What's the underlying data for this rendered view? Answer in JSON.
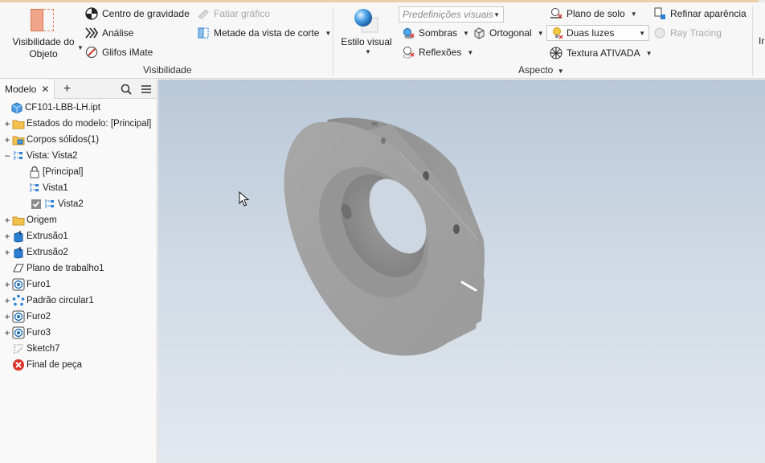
{
  "ribbon": {
    "visibilidade": {
      "object_visibility_label_1": "Visibilidade do",
      "object_visibility_label_2": "Objeto",
      "center_of_gravity": "Centro de gravidade",
      "analysis": "Análise",
      "imate_glyphs": "Glifos iMate",
      "slice_graphics": "Fatiar gráfico",
      "half_section_view": "Metade da vista de corte",
      "group_label": "Visibilidade"
    },
    "aspecto": {
      "visual_style": "Estilo visual",
      "visual_presets_placeholder": "Predefinições visuais",
      "shadows": "Sombras",
      "orthographic": "Ortogonal",
      "reflections": "Reflexões",
      "ground_plane": "Plano de solo",
      "two_lights": "Duas luzes",
      "texture_on": "Textura ATIVADA",
      "refine_appearance": "Refinar aparência",
      "ray_tracing": "Ray Tracing",
      "group_label": "Aspecto"
    },
    "next_group_partial": "Ir"
  },
  "browser": {
    "tab_label": "Modelo",
    "close_glyph": "✕",
    "add_glyph": "+",
    "tree": [
      {
        "label": "CF101-LBB-LH.ipt",
        "icon": "part-icon"
      },
      {
        "label": "Estados do modelo: [Principal]",
        "icon": "folder-icon"
      },
      {
        "label": "Corpos sólidos(1)",
        "icon": "folder-solid-icon"
      },
      {
        "label": "Vista: Vista2",
        "icon": "view-rep-icon"
      },
      {
        "label": "[Principal]",
        "icon": "lock-icon"
      },
      {
        "label": "Vista1",
        "icon": "view-rep-icon"
      },
      {
        "label": "Vista2",
        "icon": "view-rep-icon"
      },
      {
        "label": "Origem",
        "icon": "folder-icon"
      },
      {
        "label": "Extrusão1",
        "icon": "extrude-icon"
      },
      {
        "label": "Extrusão2",
        "icon": "extrude-icon"
      },
      {
        "label": "Plano de trabalho1",
        "icon": "workplane-icon"
      },
      {
        "label": "Furo1",
        "icon": "hole-icon"
      },
      {
        "label": "Padrão circular1",
        "icon": "circular-pattern-icon"
      },
      {
        "label": "Furo2",
        "icon": "hole-icon"
      },
      {
        "label": "Furo3",
        "icon": "hole-icon"
      },
      {
        "label": "Sketch7",
        "icon": "sketch-icon"
      },
      {
        "label": "Final de peça",
        "icon": "end-of-part-icon"
      }
    ]
  },
  "colors": {
    "accent_blue": "#2b7fd4",
    "folder_yellow": "#f2c14e",
    "part_gray": "#a3a3a3",
    "error_red": "#d9342b"
  }
}
